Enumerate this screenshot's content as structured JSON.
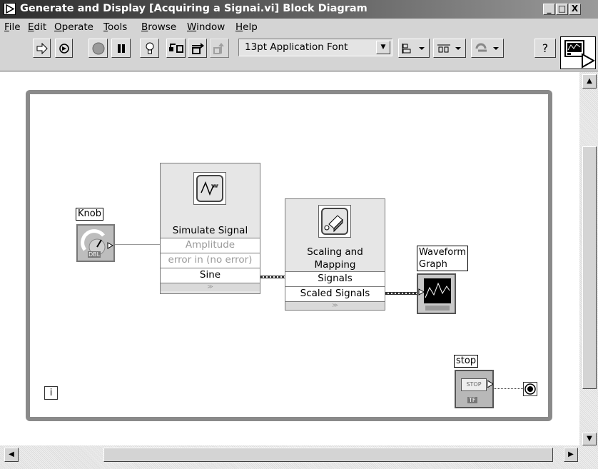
{
  "window": {
    "title": "Generate and Display [Acquiring a Signai.vi] Block Diagram",
    "minimize": "_",
    "maximize": "□",
    "close": "X"
  },
  "menu": [
    {
      "label": "File"
    },
    {
      "label": "Edit"
    },
    {
      "label": "Operate"
    },
    {
      "label": "Tools"
    },
    {
      "label": "Browse"
    },
    {
      "label": "Window"
    },
    {
      "label": "Help"
    }
  ],
  "toolbar": {
    "font": "13pt Application Font",
    "help": "?"
  },
  "diagram": {
    "knob": {
      "label": "Knob",
      "type": "DBL"
    },
    "simulate_signal": {
      "name": "Simulate Signal",
      "terminals": [
        "Amplitude",
        "error in (no error)",
        "Sine"
      ]
    },
    "scaling": {
      "name_line1": "Scaling and",
      "name_line2": "Mapping",
      "terminals": [
        "Signals",
        "Scaled Signals"
      ]
    },
    "waveform_graph": {
      "label_line1": "Waveform",
      "label_line2": "Graph"
    },
    "stop": {
      "label": "stop",
      "button_text": "STOP",
      "type": "TF"
    },
    "iteration": "i"
  }
}
